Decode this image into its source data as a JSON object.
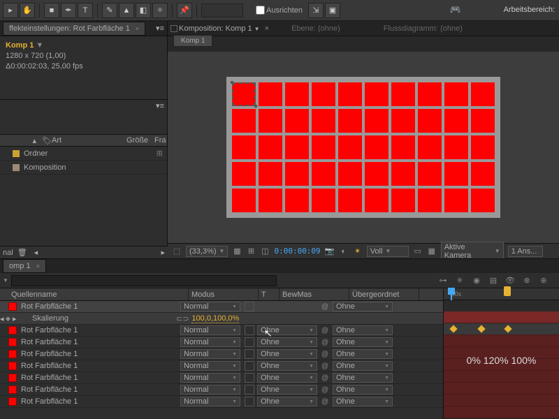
{
  "toolbar": {
    "align_label": "Ausrichten",
    "workspace_label": "Arbeitsbereich:"
  },
  "project_panel": {
    "tab_label": "ffekteinstellungen: Rot Farbfläche 1",
    "comp_name": "Komp 1",
    "dimensions": "1280 x 720 (1,00)",
    "duration": "Δ0:00:02:03, 25,00 fps",
    "col_name": "Art",
    "col_size": "Größe",
    "col_fr": "Fra",
    "folder_label": "Ordner",
    "comp_label": "Komposition",
    "footer_sel": "nal"
  },
  "viewer": {
    "tab_prefix": "Komposition:",
    "comp_name": "Komp 1",
    "ebene_label": "Ebene: (ohne)",
    "fluss_label": "Flussdiagramm: (ohne)",
    "inner_tab": "Komp 1",
    "zoom": "(33,3%)",
    "timecode": "0:00:00:09",
    "quality": "Voll",
    "camera": "Aktive Kamera",
    "views": "1 Ans..."
  },
  "timeline": {
    "tab": "omp 1",
    "hdr_name": "Quellenname",
    "hdr_mode": "Modus",
    "hdr_t": "T",
    "hdr_bm": "BewMas",
    "hdr_parent": "Übergeordnet",
    "layer_name": "Rot Farbfläche 1",
    "prop_scale": "Skalierung",
    "prop_scale_val": "100,0,100,0%",
    "mode_normal": "Normal",
    "trk_none": "Ohne",
    "parent_none": "Ohne",
    "ruler_time": ":00s",
    "keyframe_labels": "0% 120% 100%"
  }
}
